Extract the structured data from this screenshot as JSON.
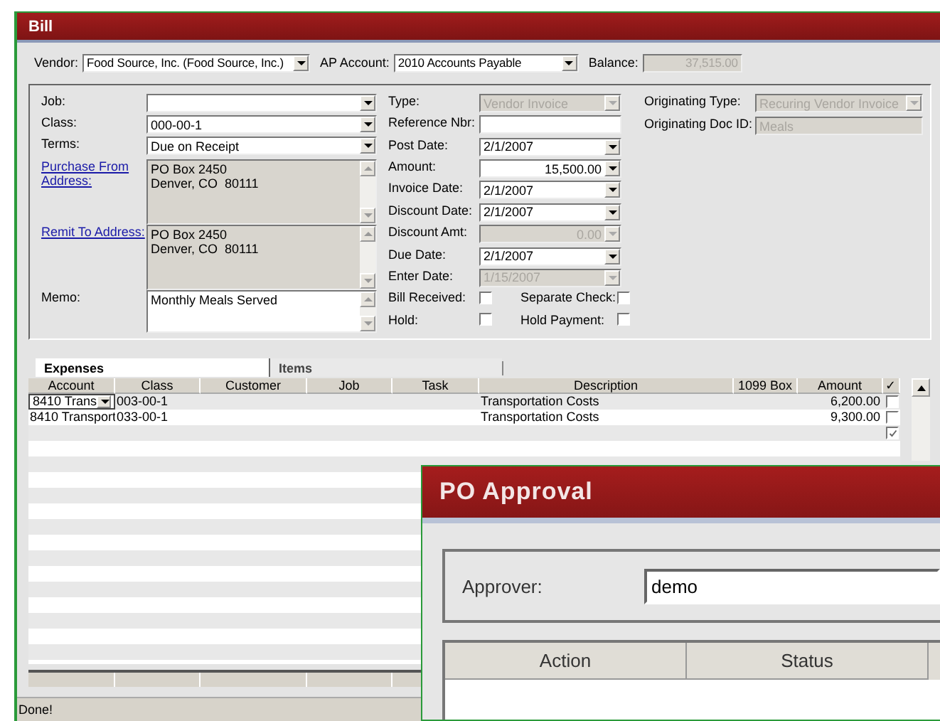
{
  "window": {
    "title": "Bill"
  },
  "header": [
    {
      "kind": "combo",
      "label": "Vendor:",
      "value": "Food Source, Inc. (Food Source, Inc.)",
      "disabled": false
    },
    {
      "kind": "combo",
      "label": "AP Account:",
      "value": "2010 Accounts Payable",
      "disabled": false
    },
    {
      "kind": "number",
      "label": "Balance:",
      "value": "37,515.00",
      "disabled": true
    }
  ],
  "form": {
    "left": [
      {
        "kind": "combo",
        "label": "Job:",
        "link": false,
        "disabled": false
      },
      {
        "kind": "combo",
        "label": "Class:",
        "value": "000-00-1",
        "link": false,
        "disabled": false
      },
      {
        "kind": "combo",
        "label": "Terms:",
        "value": "Due on Receipt",
        "link": false,
        "disabled": false
      },
      {
        "kind": "address",
        "label": "Purchase From Address:",
        "value": "PO Box 2450\nDenver, CO  80111",
        "link": true,
        "disabled": true
      },
      {
        "kind": "address",
        "label": "Remit To Address:",
        "value": "PO Box 2450\nDenver, CO  80111",
        "link": true,
        "disabled": true
      },
      {
        "kind": "memo",
        "label": "Memo:",
        "value": "Monthly Meals Served",
        "link": false,
        "disabled": false
      }
    ],
    "middle": [
      {
        "kind": "combo",
        "label": "Type:",
        "value": "Vendor Invoice",
        "disabled": true
      },
      {
        "kind": "text",
        "label": "Reference Nbr:",
        "disabled": false
      },
      {
        "kind": "combo",
        "label": "Post Date:",
        "value": "2/1/2007",
        "disabled": false
      },
      {
        "kind": "number-combo",
        "label": "Amount:",
        "value": "15,500.00",
        "disabled": false
      },
      {
        "kind": "combo",
        "label": "Invoice Date:",
        "value": "2/1/2007",
        "disabled": false
      },
      {
        "kind": "combo",
        "label": "Discount Date:",
        "value": "2/1/2007",
        "disabled": false
      },
      {
        "kind": "number-combo",
        "label": "Discount Amt:",
        "value": "0.00",
        "disabled": true
      },
      {
        "kind": "combo",
        "label": "Due Date:",
        "value": "2/1/2007",
        "disabled": false
      },
      {
        "kind": "combo",
        "label": "Enter Date:",
        "value": "1/15/2007",
        "disabled": true
      },
      {
        "kind": "checks",
        "items": [
          {
            "label": "Bill Received:",
            "checked": false
          },
          {
            "label": "Separate Check:",
            "checked": false
          }
        ]
      },
      {
        "kind": "checks",
        "items": [
          {
            "label": "Hold:",
            "checked": false
          },
          {
            "label": "Hold Payment:",
            "checked": false
          }
        ]
      }
    ],
    "right": [
      {
        "kind": "combo",
        "label": "Originating Type:",
        "value": "Recuring Vendor Invoice",
        "disabled": true
      },
      {
        "kind": "text",
        "label": "Originating Doc ID:",
        "value": "Meals",
        "disabled": true
      }
    ]
  },
  "tabs": [
    {
      "label": "Expenses",
      "selected": true
    },
    {
      "label": "Items",
      "selected": false
    }
  ],
  "grid": {
    "columns": [
      "Account",
      "Class",
      "Customer",
      "Job",
      "Task",
      "Description",
      "1099 Box",
      "Amount",
      "✓"
    ],
    "rows": [
      {
        "account": "8410 Trans",
        "editing": true,
        "class": "003-00-1",
        "description": "Transportation Costs",
        "amount": "6,200.00",
        "checked": false
      },
      {
        "account": "8410 Transport",
        "editing": false,
        "class": "033-00-1",
        "description": "Transportation Costs",
        "amount": "9,300.00",
        "checked": false
      },
      {
        "editing": false,
        "checked": true
      }
    ]
  },
  "status_bar": "Done!",
  "dialog": {
    "title": "PO Approval",
    "approver": {
      "label": "Approver:",
      "value": "demo"
    },
    "columns": [
      "Action",
      "Status"
    ]
  }
}
